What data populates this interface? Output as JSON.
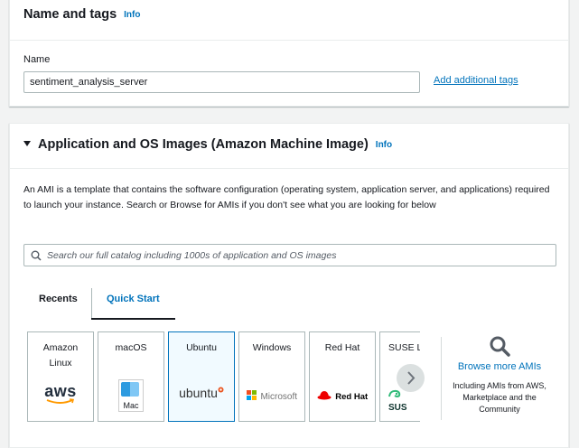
{
  "name_tags": {
    "title": "Name and tags",
    "info": "Info",
    "name_label": "Name",
    "name_value": "sentiment_analysis_server",
    "add_tags_link": "Add additional tags"
  },
  "ami": {
    "title": "Application and OS Images (Amazon Machine Image)",
    "info": "Info",
    "description": "An AMI is a template that contains the software configuration (operating system, application server, and applications) required to launch your instance. Search or Browse for AMIs if you don't see what you are looking for below",
    "search_placeholder": "Search our full catalog including 1000s of application and OS images",
    "tabs": [
      "Recents",
      "Quick Start"
    ],
    "active_tab": "Quick Start",
    "os_cards": [
      {
        "name": "Amazon Linux",
        "logo_text": "aws"
      },
      {
        "name": "macOS",
        "logo_text": "Mac"
      },
      {
        "name": "Ubuntu",
        "logo_text": "ubuntu"
      },
      {
        "name": "Windows",
        "logo_text": "Microsoft"
      },
      {
        "name": "Red Hat",
        "logo_text": "Red Hat"
      },
      {
        "name": "SUSE L",
        "logo_text": "SUS"
      }
    ],
    "selected_card": "Ubuntu",
    "browse_more_title": "Browse more AMIs",
    "browse_more_desc": "Including AMIs from AWS, Marketplace and the Community"
  },
  "colors": {
    "accent": "#0073bb",
    "border": "#aab7b8",
    "page_bg": "#f2f3f3",
    "text": "#16191f",
    "aws_orange": "#ff9900",
    "ubuntu_orange": "#e95420",
    "redhat_red": "#ee0000"
  }
}
